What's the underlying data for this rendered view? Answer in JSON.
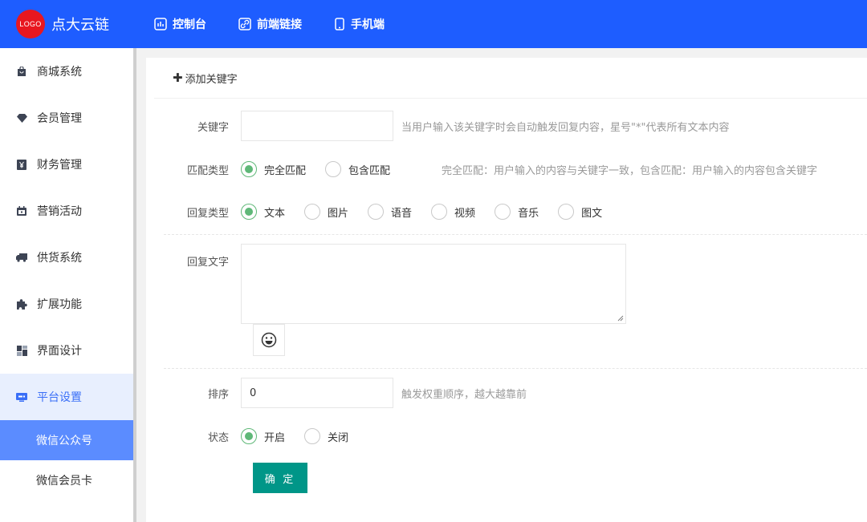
{
  "header": {
    "logo_text": "LOGO",
    "brand": "点大云链",
    "nav": [
      {
        "label": "控制台",
        "icon": "dashboard-icon"
      },
      {
        "label": "前端链接",
        "icon": "link-icon"
      },
      {
        "label": "手机端",
        "icon": "mobile-icon"
      }
    ]
  },
  "sidebar": {
    "items": [
      {
        "label": "商城系统",
        "icon": "shopping-bag-icon"
      },
      {
        "label": "会员管理",
        "icon": "diamond-icon"
      },
      {
        "label": "财务管理",
        "icon": "yen-icon"
      },
      {
        "label": "营销活动",
        "icon": "calendar-icon"
      },
      {
        "label": "供货系统",
        "icon": "truck-icon"
      },
      {
        "label": "扩展功能",
        "icon": "puzzle-icon"
      },
      {
        "label": "界面设计",
        "icon": "layout-icon"
      },
      {
        "label": "平台设置",
        "icon": "settings-panel-icon"
      }
    ],
    "sub_items": [
      {
        "label": "微信公众号"
      },
      {
        "label": "微信会员卡"
      }
    ]
  },
  "main": {
    "add_label": "添加关键字",
    "keyword": {
      "label": "关键字",
      "value": "",
      "hint": "当用户输入该关键字时会自动触发回复内容，星号\"*\"代表所有文本内容"
    },
    "match_type": {
      "label": "匹配类型",
      "options": [
        "完全匹配",
        "包含匹配"
      ],
      "selected": "完全匹配",
      "hint": "完全匹配：用户输入的内容与关键字一致，包含匹配：用户输入的内容包含关键字"
    },
    "reply_type": {
      "label": "回复类型",
      "options": [
        "文本",
        "图片",
        "语音",
        "视频",
        "音乐",
        "图文"
      ],
      "selected": "文本"
    },
    "reply_text": {
      "label": "回复文字",
      "value": ""
    },
    "sort": {
      "label": "排序",
      "value": "0",
      "hint": "触发权重顺序，越大越靠前"
    },
    "status": {
      "label": "状态",
      "options": [
        "开启",
        "关闭"
      ],
      "selected": "开启"
    },
    "confirm_label": "确 定"
  },
  "colors": {
    "header_bg": "#1e5dff",
    "logo_red": "#e8171f",
    "radio_green": "#5fb878",
    "confirm_teal": "#009688",
    "sidebar_active_bg": "#e8effe",
    "sidebar_selected_bg": "#5b8cff"
  }
}
